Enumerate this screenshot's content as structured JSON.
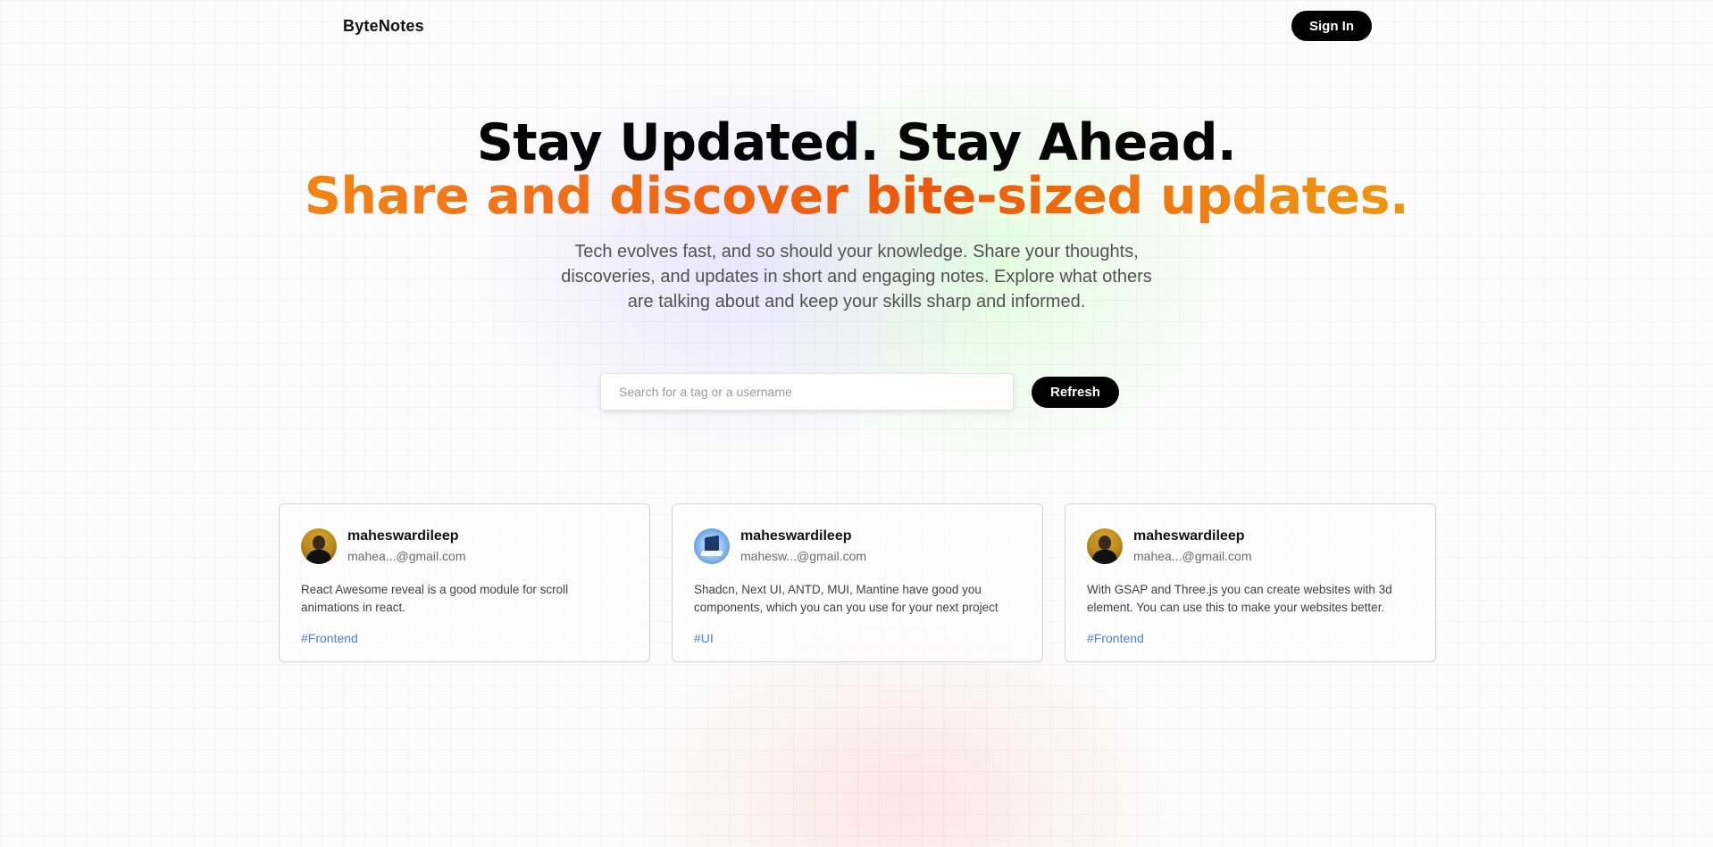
{
  "nav": {
    "brand": "ByteNotes",
    "signin_label": "Sign In"
  },
  "hero": {
    "title": "Stay Updated. Stay Ahead.",
    "subtitle": "Share and discover bite-sized updates.",
    "description": "Tech evolves fast, and so should your knowledge. Share your thoughts, discoveries, and updates in short and engaging notes. Explore what others are talking about and keep your skills sharp and informed."
  },
  "search": {
    "placeholder": "Search for a tag or a username",
    "value": "",
    "refresh_label": "Refresh"
  },
  "notes": [
    {
      "username": "maheswardileep",
      "email": "mahea...@gmail.com",
      "avatar": "person-avatar",
      "text": "React Awesome reveal is a good module for scroll animations in react.",
      "tag": "#Frontend"
    },
    {
      "username": "maheswardileep",
      "email": "mahesw...@gmail.com",
      "avatar": "tech-avatar",
      "text": "Shadcn, Next UI, ANTD, MUI, Mantine have good you components, which you can you use for your next project",
      "tag": "#UI"
    },
    {
      "username": "maheswardileep",
      "email": "mahea...@gmail.com",
      "avatar": "person-avatar",
      "text": "With GSAP and Three.js you can create websites with 3d element. You can use this to make your websites better.",
      "tag": "#Frontend"
    }
  ],
  "colors": {
    "accent_gradient_start": "#f59e0b",
    "accent_gradient_mid": "#ea580c",
    "accent_gradient_end": "#eab308",
    "tag_color": "#4f7fd6",
    "button_bg": "#000000"
  }
}
